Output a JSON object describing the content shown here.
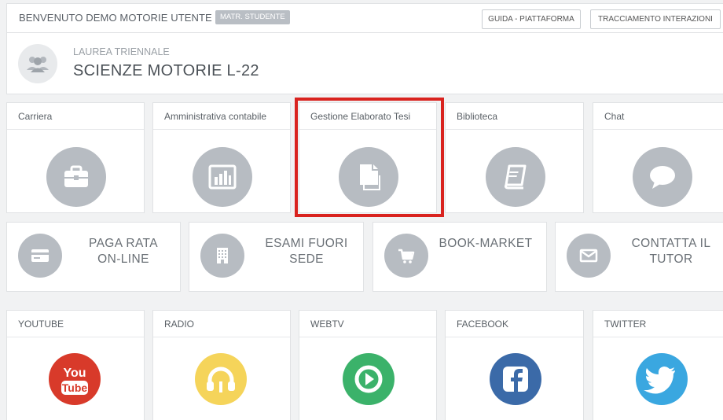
{
  "header": {
    "welcome": "BENVENUTO DEMO MOTORIE UTENTE",
    "badge": "MATR. STUDENTE",
    "guide_button": "GUIDA - PIATTAFORMA",
    "tracking_button": "TRACCIAMENTO INTERAZIONI"
  },
  "course": {
    "level": "LAUREA TRIENNALE",
    "name": "SCIENZE MOTORIE L-22",
    "icon": "users-icon"
  },
  "tiles_row1": [
    {
      "label": "Carriera",
      "icon": "briefcase-icon"
    },
    {
      "label": "Amministrativa contabile",
      "icon": "bar-chart-icon"
    },
    {
      "label": "Gestione Elaborato Tesi",
      "icon": "document-icon"
    },
    {
      "label": "Biblioteca",
      "icon": "book-icon"
    },
    {
      "label": "Chat",
      "icon": "speech-bubble-icon"
    }
  ],
  "tiles_row2": [
    {
      "label_line1": "PAGA RATA",
      "label_line2": "ON-LINE",
      "icon": "credit-card-icon"
    },
    {
      "label_line1": "ESAMI FUORI",
      "label_line2": "SEDE",
      "icon": "building-icon"
    },
    {
      "label_line1": "BOOK-MARKET",
      "label_line2": "",
      "icon": "cart-icon"
    },
    {
      "label_line1": "CONTATTA IL",
      "label_line2": "TUTOR",
      "icon": "envelope-icon"
    }
  ],
  "tiles_row3": [
    {
      "label": "YOUTUBE",
      "icon": "youtube-icon",
      "logo_line1": "You",
      "logo_line2": "Tube",
      "color": "#d83a2a"
    },
    {
      "label": "RADIO",
      "icon": "headphones-icon",
      "color": "#f5d45a"
    },
    {
      "label": "WEBTV",
      "icon": "play-icon",
      "color": "#3bb26a"
    },
    {
      "label": "FACEBOOK",
      "icon": "facebook-icon",
      "color": "#3b6aa8"
    },
    {
      "label": "TWITTER",
      "icon": "twitter-icon",
      "color": "#3aa7e0"
    }
  ],
  "colors": {
    "icon_gray": "#b7bcc2",
    "highlight": "#d9231f"
  }
}
